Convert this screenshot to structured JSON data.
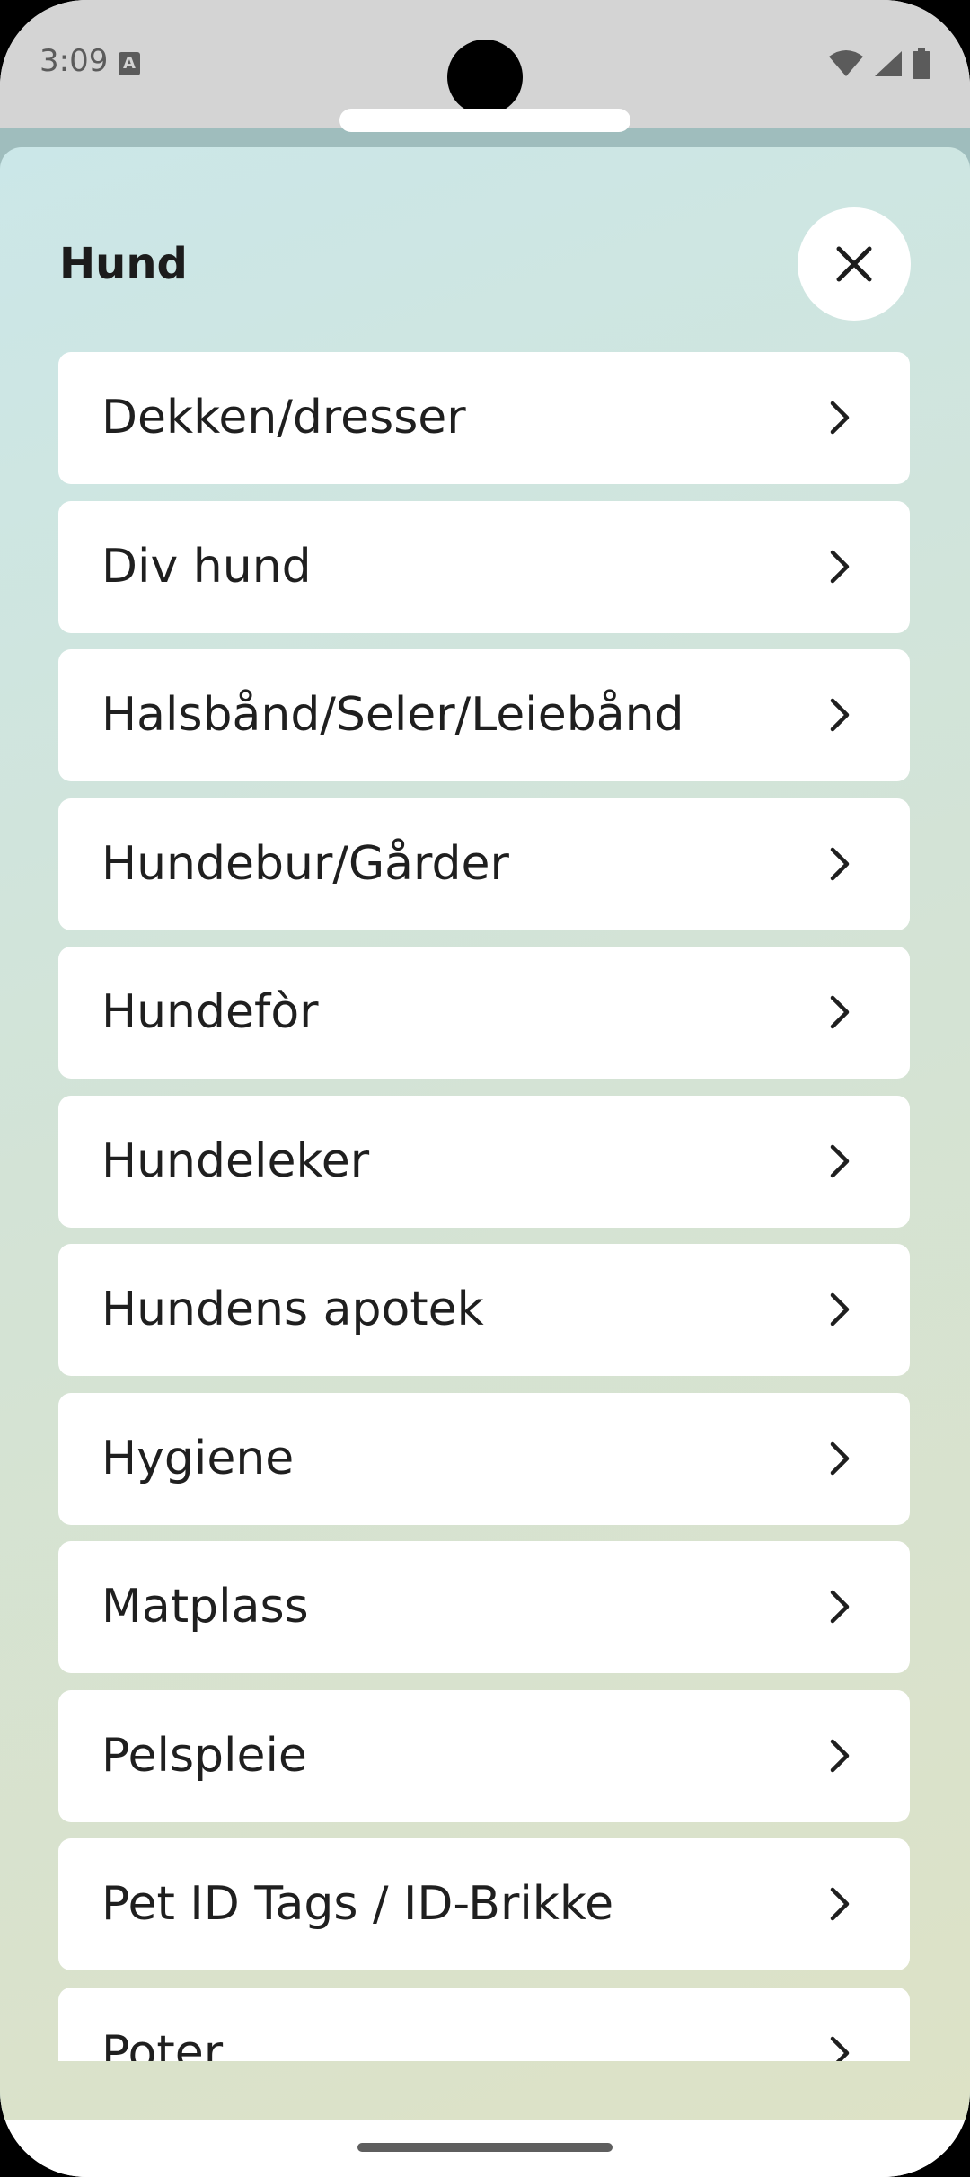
{
  "status_bar": {
    "time": "3:09",
    "notification_icon": "A",
    "icons": [
      "wifi-icon",
      "signal-icon",
      "battery-icon"
    ]
  },
  "sheet": {
    "title": "Hund",
    "close_icon": "close-icon",
    "items": [
      {
        "label": "Dekken/dresser"
      },
      {
        "label": "Div hund"
      },
      {
        "label": "Halsbånd/Seler/Leiebånd"
      },
      {
        "label": "Hundebur/Gårder"
      },
      {
        "label": "Hundefòr"
      },
      {
        "label": "Hundeleker"
      },
      {
        "label": "Hundens apotek"
      },
      {
        "label": "Hygiene"
      },
      {
        "label": "Matplass"
      },
      {
        "label": "Pelspleie"
      },
      {
        "label": "Pet ID Tags / ID-Brikke"
      },
      {
        "label": "Poter"
      }
    ]
  },
  "colors": {
    "status_bar_bg": "#d4d4d4",
    "sheet_gradient_start": "#cbe7e8",
    "sheet_gradient_end": "#dde2c6",
    "item_bg": "#ffffff",
    "text": "#1f1f1f"
  }
}
